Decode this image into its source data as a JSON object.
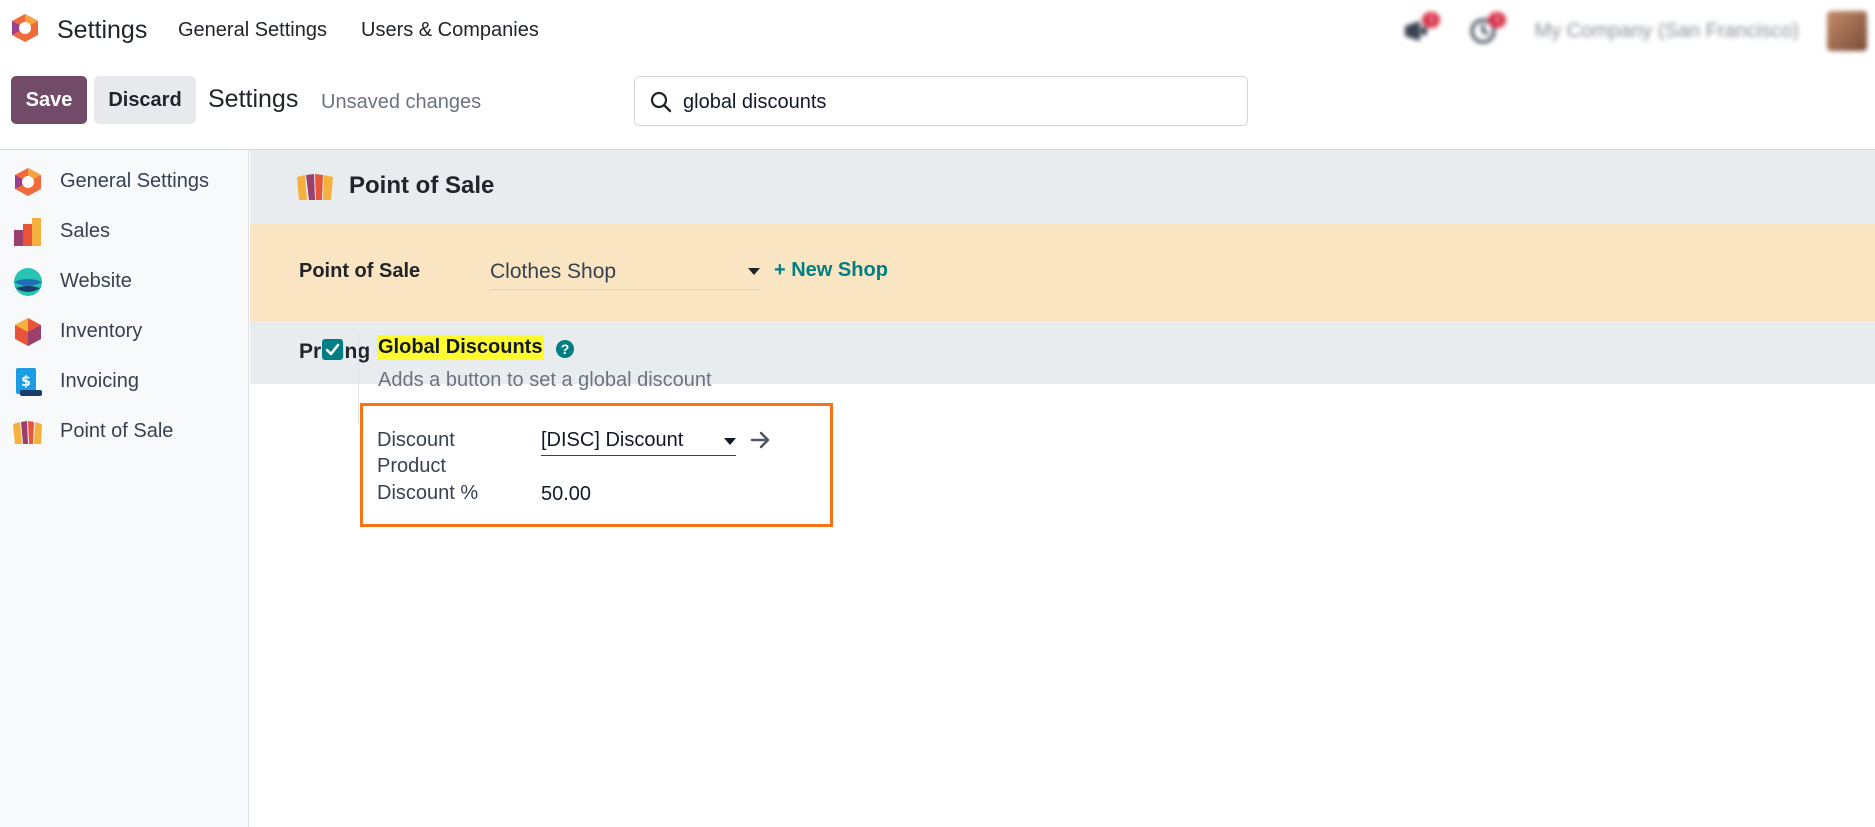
{
  "topnav": {
    "app_name": "Settings",
    "menu": [
      "General Settings",
      "Users & Companies"
    ],
    "company": "My Company (San Francisco)",
    "messages_count": "1",
    "activities_count": "1"
  },
  "controlbar": {
    "save_label": "Save",
    "discard_label": "Discard",
    "breadcrumb": "Settings",
    "status": "Unsaved changes",
    "search_value": "global discounts"
  },
  "sidebar": {
    "items": [
      {
        "label": "General Settings",
        "icon": "settings-app-icon"
      },
      {
        "label": "Sales",
        "icon": "sales-app-icon"
      },
      {
        "label": "Website",
        "icon": "website-app-icon"
      },
      {
        "label": "Inventory",
        "icon": "inventory-app-icon"
      },
      {
        "label": "Invoicing",
        "icon": "invoicing-app-icon"
      },
      {
        "label": "Point of Sale",
        "icon": "point-of-sale-app-icon"
      }
    ]
  },
  "main": {
    "section_title": "Point of Sale",
    "pos_label": "Point of Sale",
    "pos_selected": "Clothes Shop",
    "new_shop_label": "+ New Shop",
    "pricing_title": "Pricing",
    "setting": {
      "checked": true,
      "title": "Global Discounts",
      "help": "?",
      "description": "Adds a button to set a global discount",
      "product_label_line1": "Discount",
      "product_label_line2": "Product",
      "product_value": "[DISC] Discount",
      "percent_label": "Discount %",
      "percent_value": "50.00"
    }
  },
  "colors": {
    "primary": "#714b67",
    "accent": "#017e84",
    "highlight": "#fffb2c",
    "box_outline": "#f97316",
    "pos_bar": "#fae5c2"
  }
}
